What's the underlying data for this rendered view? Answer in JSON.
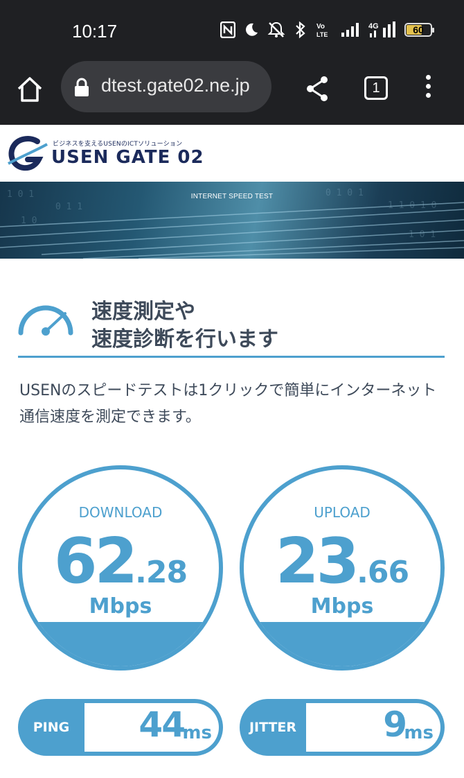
{
  "status_bar": {
    "time": "10:17",
    "battery_level": "60",
    "network_label": "4G",
    "volte_label": "Vo LTE"
  },
  "browser": {
    "url": "dtest.gate02.ne.jp",
    "tab_count": "1"
  },
  "site": {
    "logo_tagline": "ビジネスを支えるUSENのICTソリューション",
    "logo_name": "USEN GATE 02",
    "banner_title": "INTERNET SPEED TEST"
  },
  "content": {
    "heading_line1": "速度測定や",
    "heading_line2": "速度診断を行います",
    "description": "USENのスピードテストは1クリックで簡単にインターネット通信速度を測定できます。"
  },
  "results": {
    "download": {
      "label": "DOWNLOAD",
      "int": "62",
      "dec": ".28",
      "unit": "Mbps"
    },
    "upload": {
      "label": "UPLOAD",
      "int": "23",
      "dec": ".66",
      "unit": "Mbps"
    },
    "ping": {
      "label": "PING",
      "value": "44",
      "unit": "ms"
    },
    "jitter": {
      "label": "JITTER",
      "value": "9",
      "unit": "ms"
    }
  },
  "colors": {
    "accent": "#4da0ce",
    "text": "#3e4a5a",
    "brand": "#1b2a5b",
    "chrome": "#1f2023"
  },
  "icons": [
    "nfc-icon",
    "moon-icon",
    "mute-icon",
    "bluetooth-icon",
    "signal-icon",
    "battery-icon",
    "home-icon",
    "lock-icon",
    "share-icon",
    "tabs-icon",
    "menu-icon",
    "speedometer-icon"
  ]
}
